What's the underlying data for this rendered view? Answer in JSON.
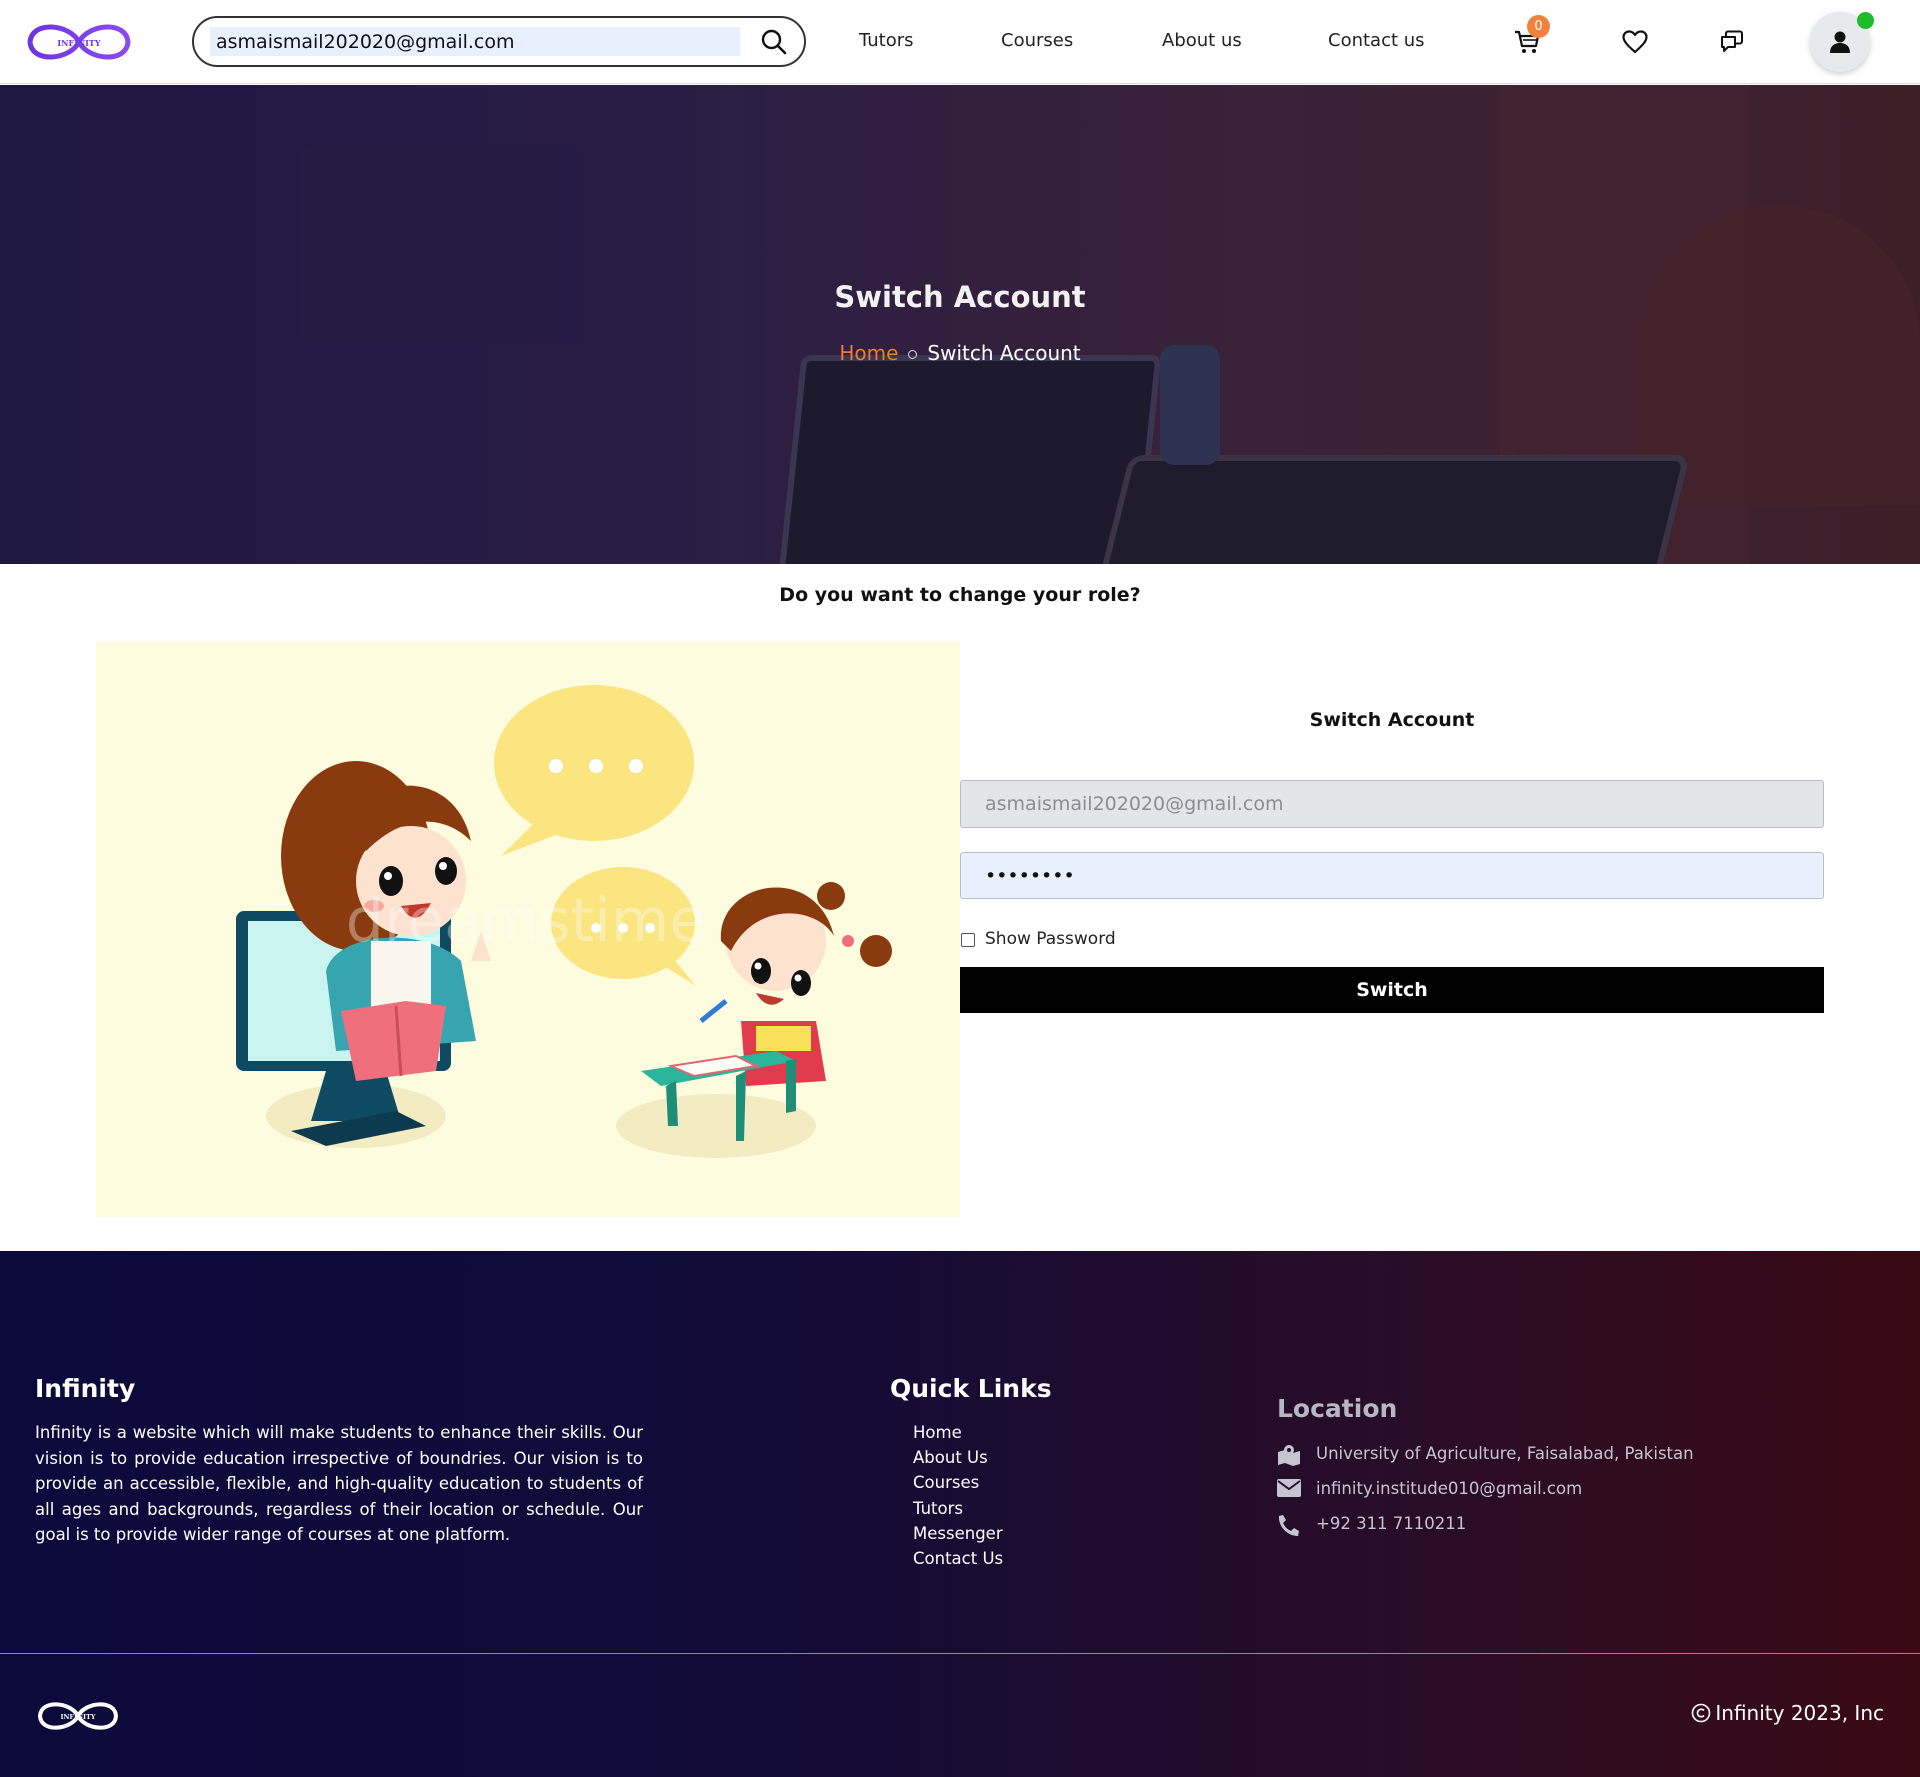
{
  "header": {
    "logo_text": "INFINITY",
    "search": {
      "value": "asmaismail202020@gmail.com"
    },
    "nav": {
      "tutors": "Tutors",
      "courses": "Courses",
      "about": "About us",
      "contact": "Contact us"
    },
    "cart_count": "0",
    "icons": [
      "cart-icon",
      "heart-icon",
      "messages-icon",
      "user-icon"
    ],
    "online_status_color": "#1bbd2d",
    "badge_color": "#f2823a"
  },
  "hero": {
    "title": "Switch Account",
    "breadcrumb": {
      "home": "Home",
      "current": "Switch Account"
    },
    "accent_color": "#ee7c30"
  },
  "main": {
    "question": "Do you want to change your role?",
    "form": {
      "title": "Switch Account",
      "email_value": "asmaismail202020@gmail.com",
      "password_value": "••••••••",
      "show_password_label": "Show Password",
      "show_password_checked": false,
      "submit_label": "Switch"
    }
  },
  "footer": {
    "brand": {
      "title": "Infinity",
      "description": "Infinity is a website which will make students to enhance their skills. Our vision is to provide education irrespective of boundries. Our vision is to provide an accessible, flexible, and high-quality education to students of all ages and backgrounds, regardless of their location or schedule. Our goal is to provide wider range of courses at one platform."
    },
    "quick_links": {
      "title": "Quick Links",
      "items": [
        "Home",
        "About Us",
        "Courses",
        "Tutors",
        "Messenger",
        "Contact Us"
      ]
    },
    "location": {
      "title": "Location",
      "address": "University of Agriculture, Faisalabad, Pakistan",
      "email": "infinity.institude010@gmail.com",
      "phone": "+92 311 7110211"
    },
    "logo_text": "INFINITY",
    "copyright": "Infinity 2023, Inc"
  }
}
